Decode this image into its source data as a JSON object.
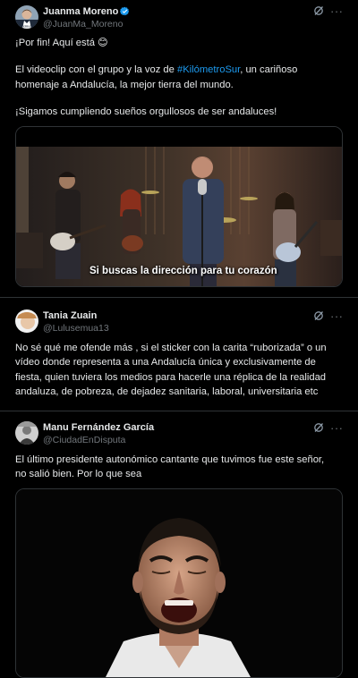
{
  "tweets": [
    {
      "name": "Juanma Moreno",
      "handle": "@JuanMa_Moreno",
      "verified": true,
      "lines": [
        "¡Por fin! Aquí está 😊",
        "El videoclip con el grupo y la voz de",
        "#KilómetroSur",
        ", un cariñoso",
        "homenaje a Andalucía, la mejor tierra del mundo.",
        "¡Sigamos cumpliendo sueños orgullosos de ser andaluces!"
      ],
      "video_caption": "Si buscas la dirección para tu corazón"
    },
    {
      "name": "Tania Zuain",
      "handle": "@Lulusemua13",
      "lines": [
        "No sé qué me ofende más , si el sticker con la carita “ruborizada” o un",
        "vídeo donde representa a una Andalucía única y exclusivamente de",
        "fiesta, quien tuviera los medios para hacerle una réplica de la realidad",
        "andaluza, de pobreza, de dejadez sanitaria, laboral, universitaria etc"
      ]
    },
    {
      "name": "Manu Fernández García",
      "handle": "@CiudadEnDisputa",
      "lines": [
        "El último presidente autonómico cantante que tuvimos fue este señor,",
        "no salió bien. Por lo que sea"
      ]
    }
  ],
  "icons": {
    "grok": "grok-icon",
    "more": "more-icon",
    "verified": "verified-badge-icon"
  },
  "colors": {
    "link": "#1d9bf0",
    "verified": "#1d9bf0",
    "separator": "#2f3336"
  }
}
